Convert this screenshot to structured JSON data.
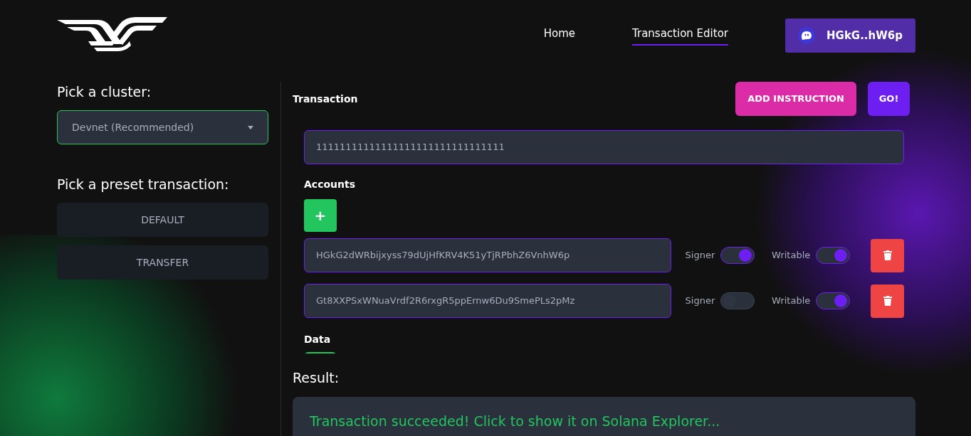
{
  "nav": {
    "links": [
      {
        "label": "Home",
        "selected": false
      },
      {
        "label": "Transaction Editor",
        "selected": true
      }
    ],
    "wallet": "HGkG..hW6p"
  },
  "sidebar": {
    "cluster_label": "Pick a cluster:",
    "cluster": "Devnet (Recommended)",
    "preset_label": "Pick a preset transaction:",
    "presets": [
      "DEFAULT",
      "TRANSFER"
    ]
  },
  "transaction": {
    "title": "Transaction",
    "add_instruction": "ADD INSTRUCTION",
    "go": "GO!",
    "program_id": "11111111111111111111111111111111",
    "accounts_label": "Accounts",
    "add_account": "+",
    "accounts": [
      {
        "address": "HGkG2dWRbijxyss79dUjHfKRV4K51yTjRPbhZ6VnhW6p",
        "signer_label": "Signer",
        "signer": true,
        "writable_label": "Writable",
        "writable": true
      },
      {
        "address": "Gt8XXPSxWNuaVrdf2R6rxgR5ppErnw6Du9SmePLs2pMz",
        "signer_label": "Signer",
        "signer": false,
        "writable_label": "Writable",
        "writable": true
      }
    ],
    "data_label": "Data"
  },
  "result": {
    "label": "Result:",
    "message": "Transaction succeeded! Click to show it on Solana Explorer..."
  }
}
